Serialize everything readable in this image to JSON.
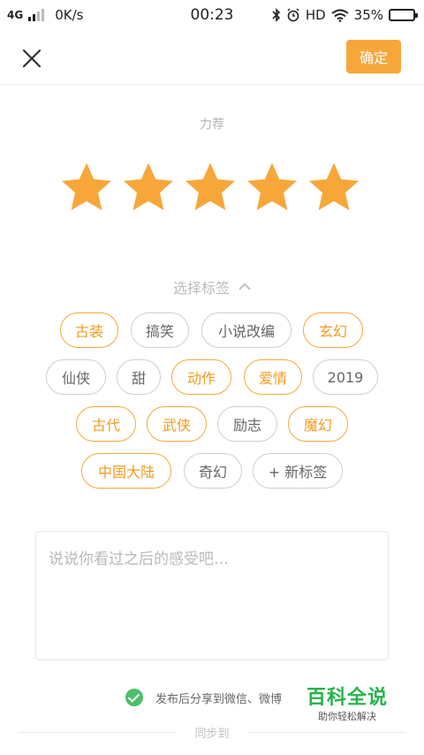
{
  "status_bar": {
    "network": "4G",
    "speed": "0K/s",
    "time": "00:23",
    "hd": "HD",
    "battery_percent": "35%",
    "battery_level": 0.35
  },
  "header": {
    "confirm_label": "确定"
  },
  "rating": {
    "label": "力荐",
    "stars": 5,
    "max": 5,
    "star_color": "#f7a73a"
  },
  "tags": {
    "title": "选择标签",
    "items": [
      {
        "label": "古装",
        "selected": true
      },
      {
        "label": "搞笑",
        "selected": false
      },
      {
        "label": "小说改编",
        "selected": false
      },
      {
        "label": "玄幻",
        "selected": true
      },
      {
        "label": "仙侠",
        "selected": false
      },
      {
        "label": "甜",
        "selected": false
      },
      {
        "label": "动作",
        "selected": true
      },
      {
        "label": "爱情",
        "selected": true
      },
      {
        "label": "2019",
        "selected": false
      },
      {
        "label": "古代",
        "selected": true
      },
      {
        "label": "武侠",
        "selected": true
      },
      {
        "label": "励志",
        "selected": false
      },
      {
        "label": "魔幻",
        "selected": true
      },
      {
        "label": "中国大陆",
        "selected": true
      },
      {
        "label": "奇幻",
        "selected": false
      },
      {
        "label": "+ 新标签",
        "selected": false
      }
    ]
  },
  "comment": {
    "placeholder": "说说你看过之后的感受吧…"
  },
  "share": {
    "checked": true,
    "text": "发布后分享到微信、微博"
  },
  "sync": {
    "label": "同步到"
  },
  "watermark": {
    "title": "百科全说",
    "subtitle": "助你轻松解决"
  },
  "colors": {
    "accent": "#f7a73a",
    "check": "#4cbf6a",
    "watermark": "#27b34a"
  }
}
